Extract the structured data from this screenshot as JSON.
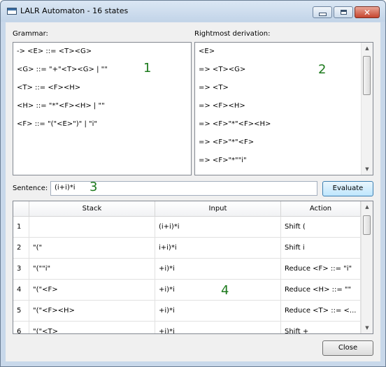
{
  "window": {
    "title": "LALR Automaton - 16 states",
    "controls": {
      "minimize": "minimize",
      "maximize": "maximize",
      "close": "✕"
    }
  },
  "grammar": {
    "label": "Grammar:",
    "lines": [
      "-> <E> ::= <T><G>",
      "<G> ::= \"+\"<T><G> | \"\"",
      "<T> ::= <F><H>",
      "<H> ::= \"*\"<F><H> | \"\"",
      "<F> ::= \"(\"<E>\")\" | \"i\""
    ],
    "annotation": "1"
  },
  "derivation": {
    "label": "Rightmost derivation:",
    "lines": [
      "<E>",
      "=> <T><G>",
      "=> <T>",
      "=> <F><H>",
      "=> <F>\"*\"<F><H>",
      "=> <F>\"*\"<F>",
      "=> <F>\"*\"\"i\""
    ],
    "annotation": "2"
  },
  "sentence": {
    "label": "Sentence:",
    "value": "(i+i)*i",
    "annotation": "3",
    "evaluate_label": "Evaluate"
  },
  "table": {
    "columns": [
      "",
      "Stack",
      "Input",
      "Action"
    ],
    "rows": [
      {
        "n": "1",
        "stack": "",
        "input": "(i+i)*i",
        "action": "Shift ("
      },
      {
        "n": "2",
        "stack": "\"(\"",
        "input": "i+i)*i",
        "action": "Shift i"
      },
      {
        "n": "3",
        "stack": "\"(\"\"i\"",
        "input": "+i)*i",
        "action": "Reduce <F> ::= \"i\""
      },
      {
        "n": "4",
        "stack": "\"(\"<F>",
        "input": "+i)*i",
        "action": "Reduce <H> ::= \"\""
      },
      {
        "n": "5",
        "stack": "\"(\"<F><H>",
        "input": "+i)*i",
        "action": "Reduce <T> ::= <..."
      },
      {
        "n": "6",
        "stack": "\"(\"<T>",
        "input": "+i)*i",
        "action": "Shift +"
      }
    ],
    "annotation": "4"
  },
  "close_label": "Close",
  "colors": {
    "annotation": "#1d7a1d",
    "titlebar": "#c8d8ea",
    "close_button": "#c6452f"
  }
}
